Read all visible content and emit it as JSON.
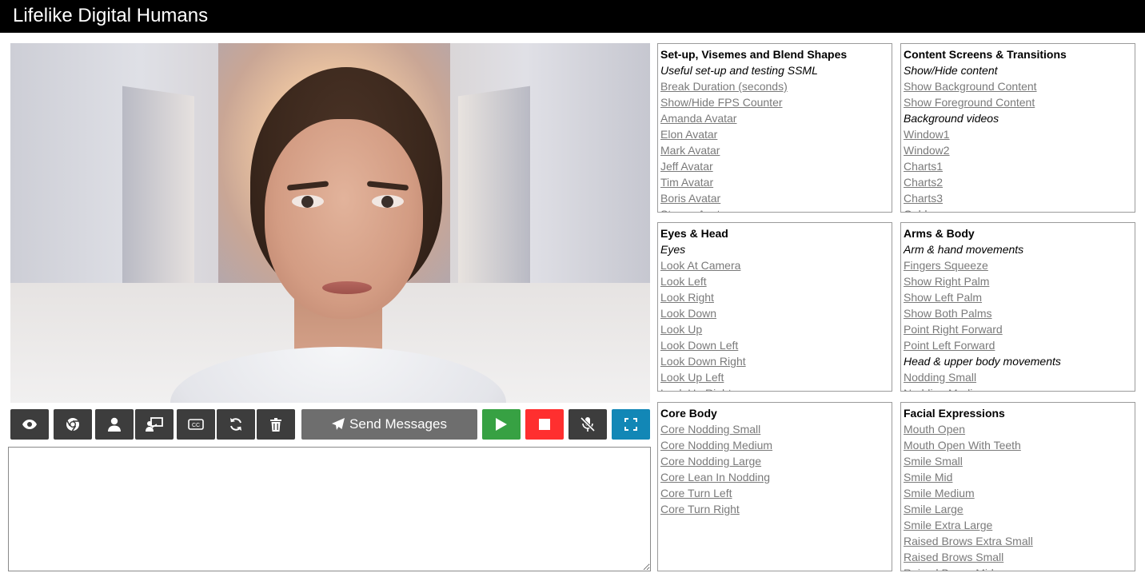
{
  "header": {
    "title": "Lifelike Digital Humans"
  },
  "controls": {
    "send_label": "Send Messages",
    "message_placeholder": ""
  },
  "colors": {
    "play": "#37a143",
    "stop": "#ff2f2f",
    "fullscreen": "#1287b6",
    "dark_button": "#3d3d3d",
    "send_button": "#6e6e6e"
  },
  "icons": {
    "toolbar": [
      "eye-icon",
      "chrome-icon",
      "user-icon",
      "presenter-icon",
      "closed-captions-icon",
      "refresh-icon",
      "trash-icon",
      "paper-plane-icon",
      "play-icon",
      "stop-icon",
      "microphone-slash-icon",
      "expand-icon"
    ]
  },
  "panels": {
    "setup": {
      "title": "Set-up, Visemes and Blend Shapes",
      "rows": [
        {
          "type": "sub",
          "text": "Useful set-up and testing SSML"
        },
        {
          "type": "link",
          "text": "Break Duration (seconds)"
        },
        {
          "type": "link",
          "text": "Show/Hide FPS Counter"
        },
        {
          "type": "link",
          "text": "Amanda Avatar"
        },
        {
          "type": "link",
          "text": "Elon Avatar"
        },
        {
          "type": "link",
          "text": "Mark Avatar"
        },
        {
          "type": "link",
          "text": "Jeff Avatar"
        },
        {
          "type": "link",
          "text": "Tim Avatar"
        },
        {
          "type": "link",
          "text": "Boris Avatar"
        },
        {
          "type": "link",
          "text": "Steven Avatar"
        }
      ]
    },
    "content": {
      "title": "Content Screens & Transitions",
      "rows": [
        {
          "type": "sub",
          "text": "Show/Hide content"
        },
        {
          "type": "link",
          "text": "Show Background Content"
        },
        {
          "type": "link",
          "text": "Show Foreground Content"
        },
        {
          "type": "sub",
          "text": "Background videos"
        },
        {
          "type": "link",
          "text": "Window1"
        },
        {
          "type": "link",
          "text": "Window2"
        },
        {
          "type": "link",
          "text": "Charts1"
        },
        {
          "type": "link",
          "text": "Charts2"
        },
        {
          "type": "link",
          "text": "Charts3"
        },
        {
          "type": "link",
          "text": "Gold"
        }
      ]
    },
    "eyes": {
      "title": "Eyes & Head",
      "rows": [
        {
          "type": "sub",
          "text": "Eyes"
        },
        {
          "type": "link",
          "text": "Look At Camera"
        },
        {
          "type": "link",
          "text": "Look Left"
        },
        {
          "type": "link",
          "text": "Look Right"
        },
        {
          "type": "link",
          "text": "Look Down"
        },
        {
          "type": "link",
          "text": "Look Up"
        },
        {
          "type": "link",
          "text": "Look Down Left"
        },
        {
          "type": "link",
          "text": "Look Down Right"
        },
        {
          "type": "link",
          "text": "Look Up Left"
        },
        {
          "type": "link",
          "text": "Look Up Right"
        }
      ]
    },
    "arms": {
      "title": "Arms & Body",
      "rows": [
        {
          "type": "sub",
          "text": "Arm & hand movements"
        },
        {
          "type": "link",
          "text": "Fingers Squeeze"
        },
        {
          "type": "link",
          "text": "Show Right Palm"
        },
        {
          "type": "link",
          "text": "Show Left Palm"
        },
        {
          "type": "link",
          "text": "Show Both Palms"
        },
        {
          "type": "link",
          "text": "Point Right Forward"
        },
        {
          "type": "link",
          "text": "Point Left Forward"
        },
        {
          "type": "sub",
          "text": "Head & upper body movements"
        },
        {
          "type": "link",
          "text": "Nodding Small"
        },
        {
          "type": "link",
          "text": "Nodding Medium"
        }
      ]
    },
    "core": {
      "title": "Core Body",
      "rows": [
        {
          "type": "link",
          "text": "Core Nodding Small"
        },
        {
          "type": "link",
          "text": "Core Nodding Medium"
        },
        {
          "type": "link",
          "text": "Core Nodding Large"
        },
        {
          "type": "link",
          "text": "Core Lean In Nodding"
        },
        {
          "type": "link",
          "text": "Core Turn Left"
        },
        {
          "type": "link",
          "text": "Core Turn Right"
        }
      ]
    },
    "facial": {
      "title": "Facial Expressions",
      "rows": [
        {
          "type": "link",
          "text": "Mouth Open"
        },
        {
          "type": "link",
          "text": "Mouth Open With Teeth"
        },
        {
          "type": "link",
          "text": "Smile Small"
        },
        {
          "type": "link",
          "text": "Smile Mid"
        },
        {
          "type": "link",
          "text": "Smile Medium"
        },
        {
          "type": "link",
          "text": "Smile Large"
        },
        {
          "type": "link",
          "text": "Smile Extra Large"
        },
        {
          "type": "link",
          "text": "Raised Brows Extra Small"
        },
        {
          "type": "link",
          "text": "Raised Brows Small"
        },
        {
          "type": "link",
          "text": "Raised Brows Mid"
        }
      ]
    }
  }
}
